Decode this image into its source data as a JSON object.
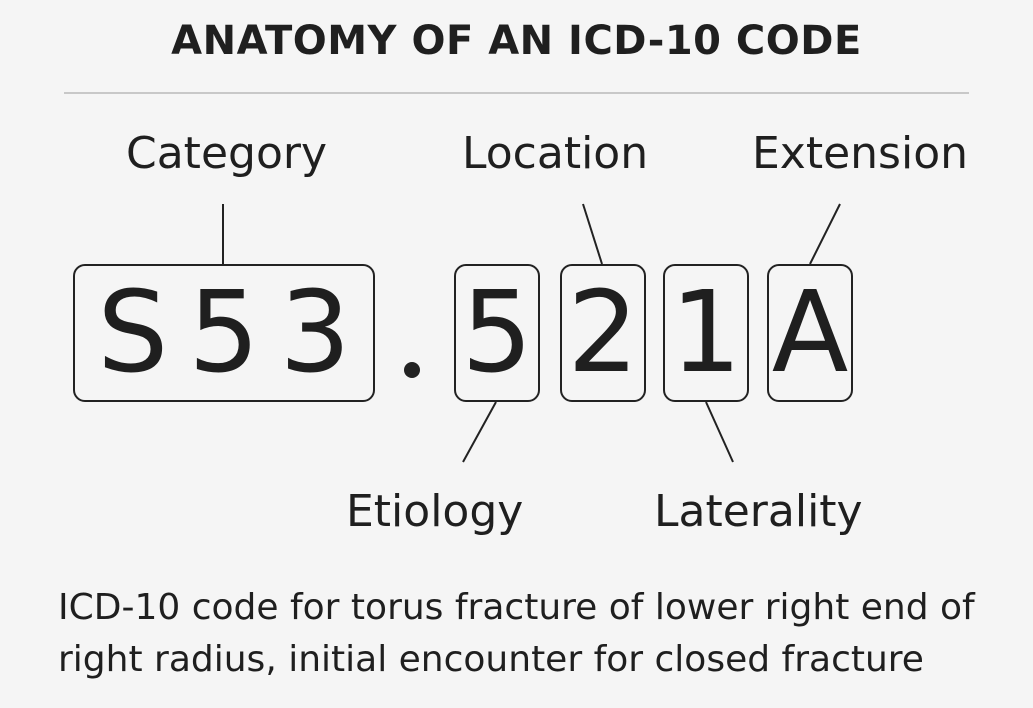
{
  "title": "ANATOMY OF AN ICD-10 CODE",
  "code": {
    "category_chars": [
      "S",
      "5",
      "3"
    ],
    "separator": ".",
    "etiology": "5",
    "location": "2",
    "laterality": "1",
    "extension": "A"
  },
  "labels": {
    "category": "Category",
    "location": "Location",
    "extension": "Extension",
    "etiology": "Etiology",
    "laterality": "Laterality"
  },
  "caption": "ICD-10 code for torus fracture of lower right end of right radius, initial encounter for closed fracture"
}
